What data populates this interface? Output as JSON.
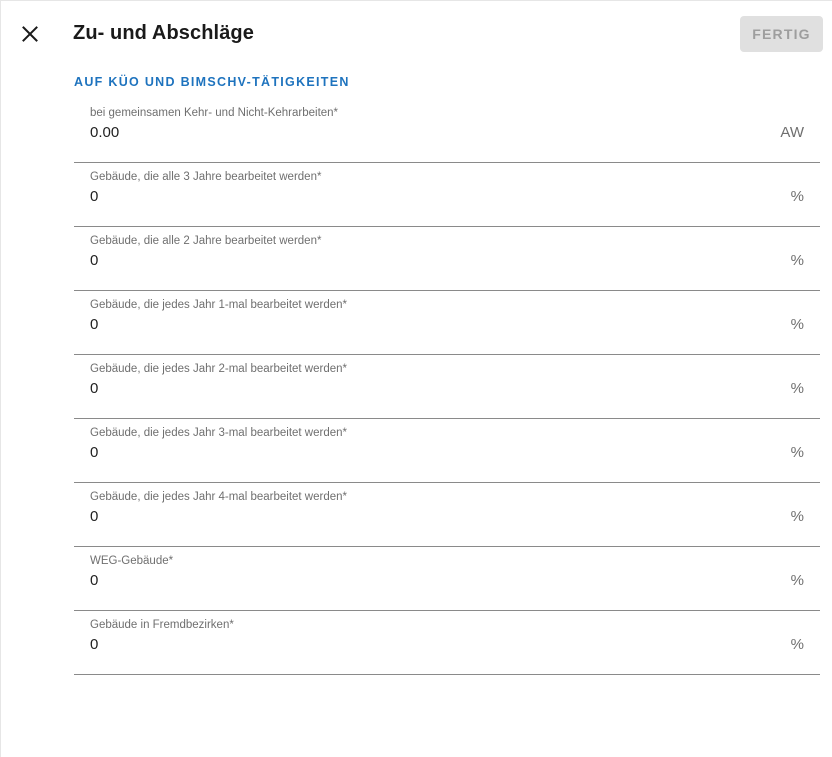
{
  "dialog": {
    "title": "Zu- und Abschläge",
    "done_label": "FERTIG",
    "close_icon": "close-icon"
  },
  "section": {
    "heading": "AUF KÜO UND BIMSCHV-TÄTIGKEITEN"
  },
  "fields": [
    {
      "label": "bei gemeinsamen Kehr- und Nicht-Kehrarbeiten*",
      "value": "0.00",
      "unit": "AW"
    },
    {
      "label": "Gebäude, die alle 3 Jahre bearbeitet werden*",
      "value": "0",
      "unit": "%"
    },
    {
      "label": "Gebäude, die alle 2 Jahre bearbeitet werden*",
      "value": "0",
      "unit": "%"
    },
    {
      "label": "Gebäude, die jedes Jahr 1-mal bearbeitet werden*",
      "value": "0",
      "unit": "%"
    },
    {
      "label": "Gebäude, die jedes Jahr 2-mal bearbeitet werden*",
      "value": "0",
      "unit": "%"
    },
    {
      "label": "Gebäude, die jedes Jahr 3-mal bearbeitet werden*",
      "value": "0",
      "unit": "%"
    },
    {
      "label": "Gebäude, die jedes Jahr 4-mal bearbeitet werden*",
      "value": "0",
      "unit": "%"
    },
    {
      "label": "WEG-Gebäude*",
      "value": "0",
      "unit": "%"
    },
    {
      "label": "Gebäude in Fremdbezirken*",
      "value": "0",
      "unit": "%"
    }
  ],
  "colors": {
    "accent": "#1e73be",
    "button_bg": "#e0e0e0",
    "button_text": "#9e9e9e"
  }
}
